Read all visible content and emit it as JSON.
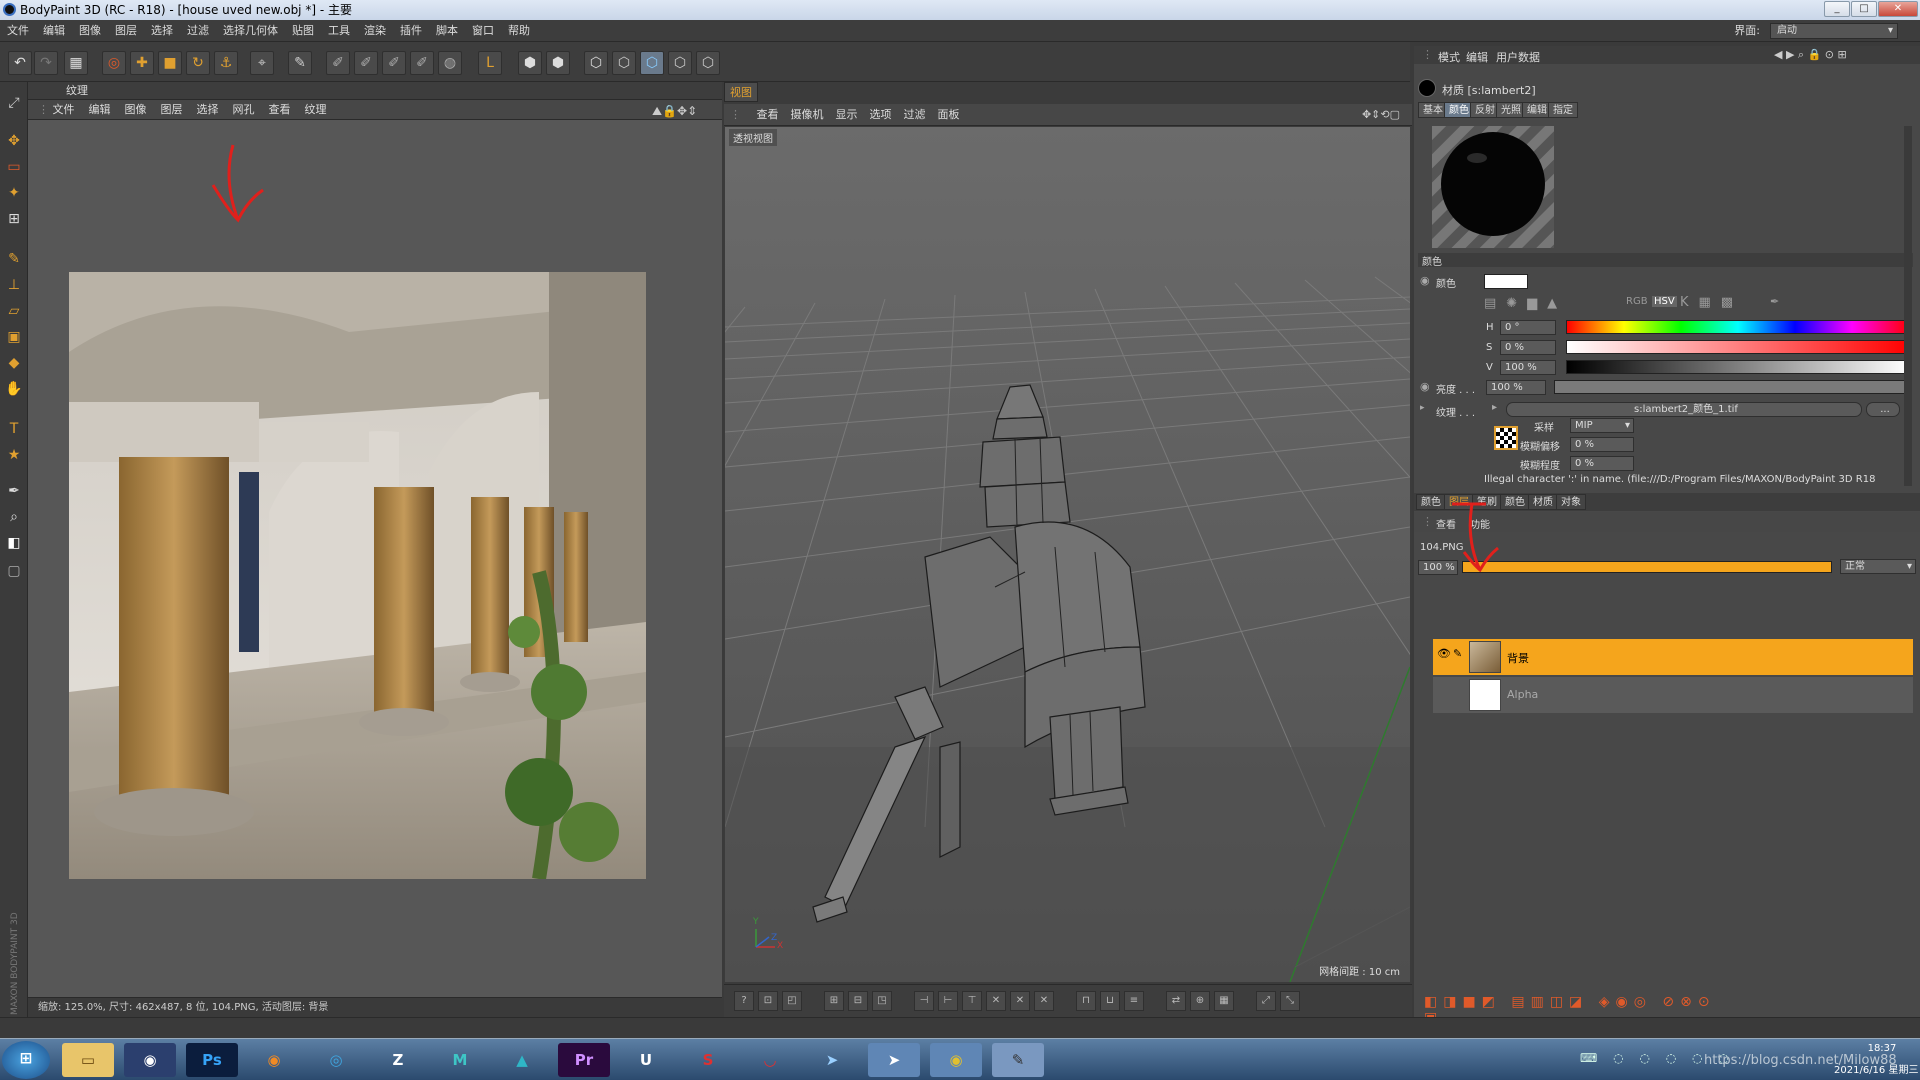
{
  "window": {
    "title": "BodyPaint 3D (RC - R18) - [house uved new.obj *] - 主要",
    "minimize": "_",
    "maximize": "□",
    "close": "✕"
  },
  "menubar": [
    "文件",
    "编辑",
    "图像",
    "图层",
    "选择",
    "过滤",
    "选择几何体",
    "贴图",
    "工具",
    "渲染",
    "插件",
    "脚本",
    "窗口",
    "帮助"
  ],
  "layout": {
    "label": "界面:",
    "value": "启动"
  },
  "texture_panel": {
    "title": "纹理",
    "menu": [
      "文件",
      "编辑",
      "图像",
      "图层",
      "选择",
      "网孔",
      "查看",
      "纹理"
    ],
    "status": "缩放: 125.0%, 尺寸: 462x487, 8 位, 104.PNG, 活动图层: 背景"
  },
  "viewport": {
    "tab": "视图",
    "menu": [
      "查看",
      "摄像机",
      "显示",
      "选项",
      "过滤",
      "面板"
    ],
    "label": "透视视图",
    "grid_spacing": "网格间距 : 10 cm",
    "axis_y": "Y",
    "axis_x": "X",
    "axis_z": "Z"
  },
  "attributes": {
    "menu": [
      "模式",
      "编辑",
      "用户数据"
    ],
    "material": "材质 [s:lambert2]",
    "tabs": [
      "基本",
      "颜色",
      "反射",
      "光照",
      "编辑",
      "指定"
    ],
    "active_tab": "颜色",
    "section": "颜色",
    "color_label": "颜色",
    "h_label": "H",
    "h_value": "0 °",
    "s_label": "S",
    "s_value": "0 %",
    "v_label": "V",
    "v_value": "100 %",
    "brightness_label": "亮度 . . .",
    "brightness_value": "100 %",
    "texture_label": "纹理 . . .",
    "texture_file": "s:lambert2_颜色_1.tif",
    "texture_more": "...",
    "sampling_label": "采样",
    "sampling_value": "MIP",
    "blur_offset_label": "模糊偏移",
    "blur_offset_value": "0 %",
    "blur_scale_label": "模糊程度",
    "blur_scale_value": "0 %",
    "error": "Illegal character ':' in name. (file:///D:/Program Files/MAXON/BodyPaint 3D R18"
  },
  "layers_panel": {
    "tabs": [
      "颜色",
      "图层",
      "笔刷",
      "颜色",
      "材质",
      "对象"
    ],
    "active_tab": "图层",
    "menu": [
      "查看",
      "功能"
    ],
    "file": "104.PNG",
    "opacity": "100 %",
    "blend": "正常",
    "layers": [
      "背景",
      "Alpha"
    ]
  },
  "watermark": "https://blog.csdn.net/Milow88",
  "clock": {
    "time": "18:37",
    "date": "2021/6/16 星期三"
  },
  "taskbar_apps": [
    "start-button",
    "explorer",
    "cinema4d",
    "photoshop",
    "blender",
    "app-blue",
    "zbrush",
    "maya",
    "3dsmax",
    "premiere",
    "unreal",
    "substance",
    "cloud-app",
    "qq-app",
    "feishu",
    "chrome",
    "bodypaint"
  ],
  "side_brand": "MAXON BODYPAINT 3D",
  "colors": {
    "accent": "#f5a51c",
    "panel": "#575757",
    "dark": "#3d3d3d",
    "annotation": "#e0201c"
  }
}
